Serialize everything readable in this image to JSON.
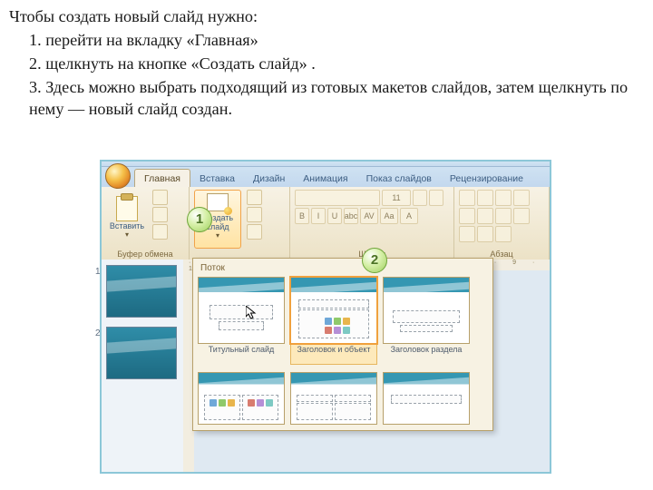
{
  "instructions": {
    "intro": "Чтобы создать новый слайд нужно:",
    "i1": "1. перейти на вкладку «Главная»",
    "i2": "2. щелкнуть на кнопке «Создать слайд» .",
    "i3": "3. Здесь  можно выбрать подходящий из готовых макетов слайдов, затем щелкнуть по нему — новый слайд создан."
  },
  "tabs": {
    "home": "Главная",
    "insert": "Вставка",
    "design": "Дизайн",
    "anim": "Анимация",
    "show": "Показ слайдов",
    "review": "Рецензирование"
  },
  "ribbon": {
    "paste": "Вставить",
    "clipboard": "Буфер обмена",
    "newslide_l1": "Создать",
    "newslide_l2": "слайд",
    "font_name": "",
    "font_size": "11",
    "font": "Шрифт",
    "para": "Абзац"
  },
  "markers": {
    "m1": "1",
    "m2": "2"
  },
  "thumbs": {
    "n1": "1",
    "n2": "2"
  },
  "gallery": {
    "title": "Поток",
    "l1": "Титульный слайд",
    "l2": "Заголовок и объект",
    "l3": "Заголовок раздела"
  },
  "ruler": "· 1 · 2 · 3 · 4 · 5 · 6 · 7 · 8 · 9 · 10 · 11 · 12"
}
